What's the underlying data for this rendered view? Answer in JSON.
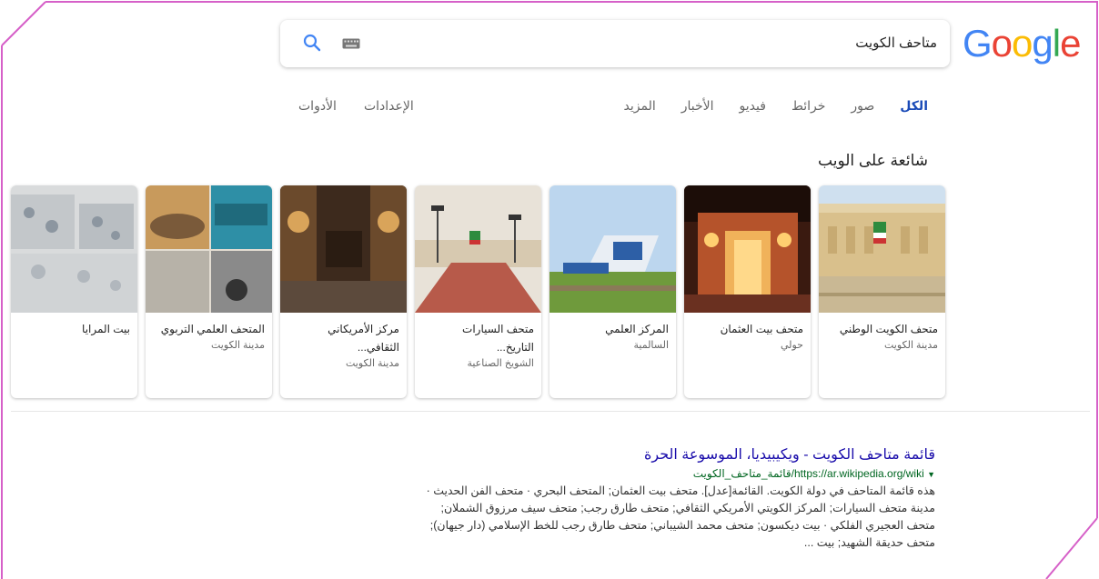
{
  "logo": {
    "letters": [
      "G",
      "o",
      "o",
      "g",
      "l",
      "e"
    ],
    "colors": [
      "#4285F4",
      "#EA4335",
      "#FBBC05",
      "#4285F4",
      "#34A853",
      "#EA4335"
    ]
  },
  "search": {
    "query": "متاحف الكويت",
    "icons": [
      "search-icon",
      "keyboard-icon"
    ]
  },
  "tabs": [
    {
      "label": "الكل",
      "active": true
    },
    {
      "label": "صور"
    },
    {
      "label": "خرائط"
    },
    {
      "label": "فيديو"
    },
    {
      "label": "الأخبار"
    },
    {
      "label": "المزيد"
    }
  ],
  "tools": [
    {
      "label": "الإعدادات"
    },
    {
      "label": "الأدوات"
    }
  ],
  "trending_title": "شائعة على الويب",
  "cards": [
    {
      "name": "متحف الكويت الوطني",
      "location": "مدينة الكويت"
    },
    {
      "name": "متحف بيت العثمان",
      "location": "حولي"
    },
    {
      "name": "المركز العلمي",
      "location": "السالمية"
    },
    {
      "name": "متحف السيارات التاريخ...",
      "location": "الشويخ الصناعية"
    },
    {
      "name": "مركز الأمريكاني الثقافي...",
      "location": "مدينة الكويت"
    },
    {
      "name": "المتحف العلمي التربوي",
      "location": "مدينة الكويت"
    },
    {
      "name": "بيت المرايا",
      "location": ""
    }
  ],
  "result": {
    "title": "قائمة متاحف الكويت - ويكيبيديا، الموسوعة الحرة",
    "url": "https://ar.wikipedia.org/wiki/قائمة_متاحف_الكويت",
    "snippet": [
      "هذه قائمة المتاحف في دولة الكويت. القائمة[عدل]. متحف بيت العثمان; المتحف البحري · متحف الفن الحديث ·",
      "مدينة متحف السيارات; المركز الكويتي الأمريكي الثقافي; متحف طارق رجب; متحف سيف مرزوق الشملان;",
      "متحف العجيري الفلكي · بيت ديكسون; متحف محمد الشيباني; متحف طارق رجب للخط الإسلامي (دار جيهان);",
      "متحف حديقة الشهيد; بيت ..."
    ]
  }
}
